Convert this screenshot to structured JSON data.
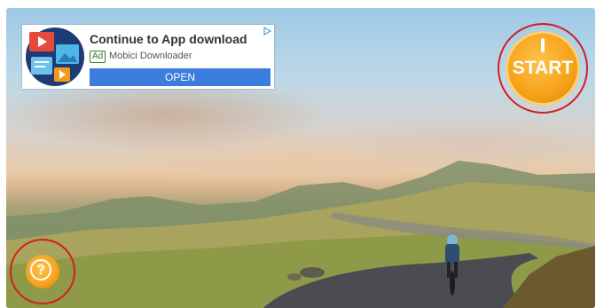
{
  "ad": {
    "title": "Continue to App download",
    "badge": "Ad",
    "advertiser": "Mobici Downloader",
    "cta": "OPEN",
    "logo_icon": "media-apps-icon",
    "choices_icon": "adchoices-icon"
  },
  "controls": {
    "start_label": "START",
    "start_icon": "power-icon",
    "help_symbol": "?",
    "help_icon": "question-mark-icon",
    "accent_color": "#f6a21a",
    "highlight_color": "#d31e24"
  },
  "background": {
    "scene": "landscape-photo-icon"
  }
}
